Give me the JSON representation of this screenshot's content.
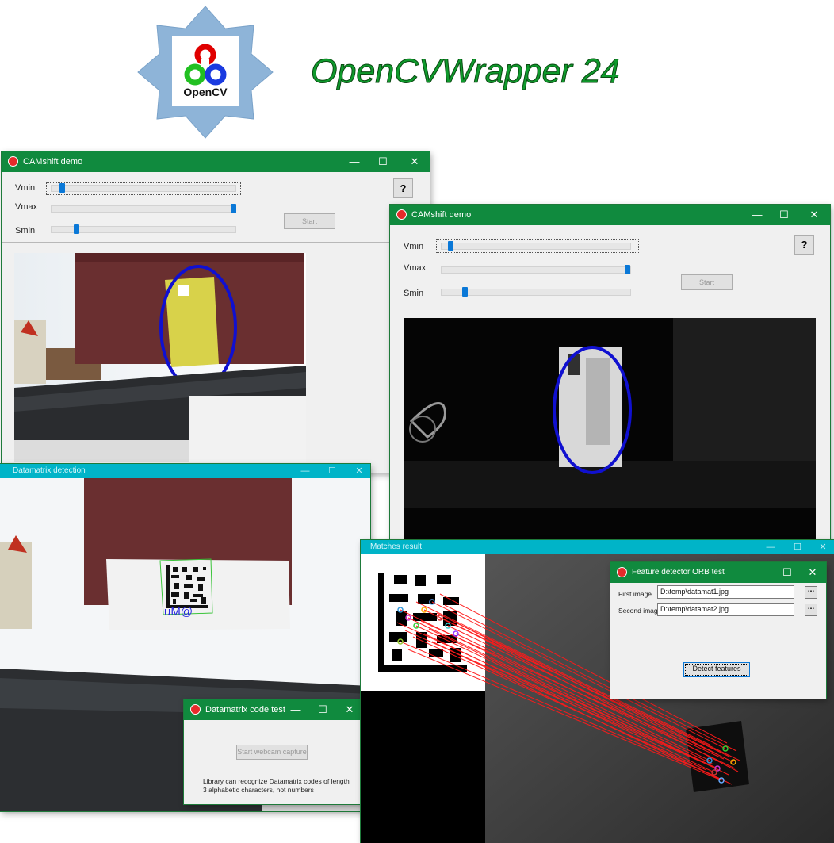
{
  "banner": {
    "title": "OpenCVWrapper 24",
    "logo_text": "OpenCV"
  },
  "camshift1": {
    "title": "CAMshift demo",
    "labels": {
      "vmin": "Vmin",
      "vmax": "Vmax",
      "smin": "Smin"
    },
    "help": "?",
    "start": "Start",
    "sliders": {
      "vmin": 0.05,
      "vmax": 1.0,
      "smin": 0.13
    }
  },
  "camshift2": {
    "title": "CAMshift demo",
    "labels": {
      "vmin": "Vmin",
      "vmax": "Vmax",
      "smin": "Smin"
    },
    "help": "?",
    "start": "Start",
    "sliders": {
      "vmin": 0.05,
      "vmax": 1.0,
      "smin": 0.13
    }
  },
  "datamatrix_detection": {
    "title": "Datamatrix detection",
    "decoded": "uM@"
  },
  "datamatrix_test": {
    "title": "Datamatrix code test",
    "capture_button": "Start webcam capture",
    "note_line1": "Library can recognize Datamatrix codes of length",
    "note_line2": "3 alphabetic characters, not numbers"
  },
  "matches": {
    "title": "Matches result"
  },
  "orb": {
    "title": "Feature detector ORB test",
    "first_label": "First image",
    "first_value": "D:\\temp\\datamat1.jpg",
    "second_label": "Second image",
    "second_value": "D:\\temp\\datamat2.jpg",
    "browse": "...",
    "detect": "Detect features"
  },
  "window_controls": {
    "minimize": "—",
    "maximize": "☐",
    "close": "✕"
  },
  "colors": {
    "title_green": "#108a3e",
    "cyan_bar": "#00b4c8",
    "ellipse_blue": "#1010d0",
    "match_red": "#ff0000",
    "slider_blue": "#0a78d7"
  }
}
